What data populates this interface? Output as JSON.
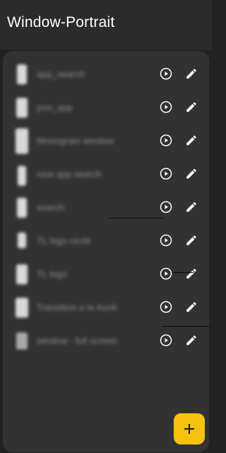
{
  "header": {
    "title": "Window-Portrait"
  },
  "items": [
    {
      "label": "app_search"
    },
    {
      "label": "pnn_app"
    },
    {
      "label": "Monogram window"
    },
    {
      "label": "new app search"
    },
    {
      "label": "search"
    },
    {
      "label": "TL logo circle"
    },
    {
      "label": "TL logo"
    },
    {
      "label": "Transition a la Aunk"
    },
    {
      "label": "window - full screen"
    }
  ],
  "fab": {
    "icon": "plus-icon"
  },
  "colors": {
    "accent": "#f6c20d",
    "background": "#222222",
    "panel": "#323232"
  }
}
